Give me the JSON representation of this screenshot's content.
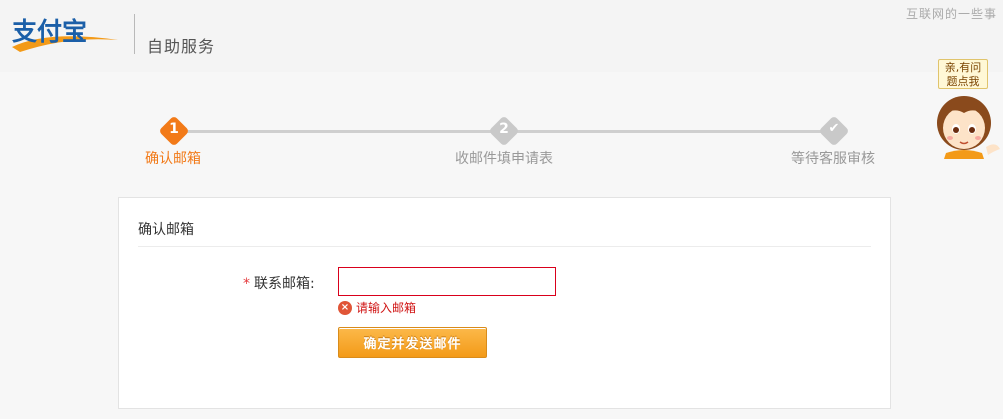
{
  "header": {
    "logo_text": "支付宝",
    "service_title": "自助服务",
    "top_link": "互联网的一些事"
  },
  "helper": {
    "bubble_line1": "亲,有问",
    "bubble_line2": "题点我"
  },
  "steps": [
    {
      "num": "1",
      "label": "确认邮箱",
      "state": "active",
      "color": "#f27a18"
    },
    {
      "num": "2",
      "label": "收邮件填申请表",
      "state": "pending",
      "color": "#c9c9c9"
    },
    {
      "num": "✔",
      "label": "等待客服审核",
      "state": "pending",
      "color": "#c9c9c9"
    }
  ],
  "form": {
    "title": "确认邮箱",
    "required_mark": "*",
    "email_label": "联系邮箱:",
    "email_value": "",
    "error_message": "请输入邮箱",
    "submit_label": "确定并发送邮件"
  },
  "colors": {
    "accent": "#f27a18",
    "error": "#d01414",
    "button": "#f39a18"
  }
}
